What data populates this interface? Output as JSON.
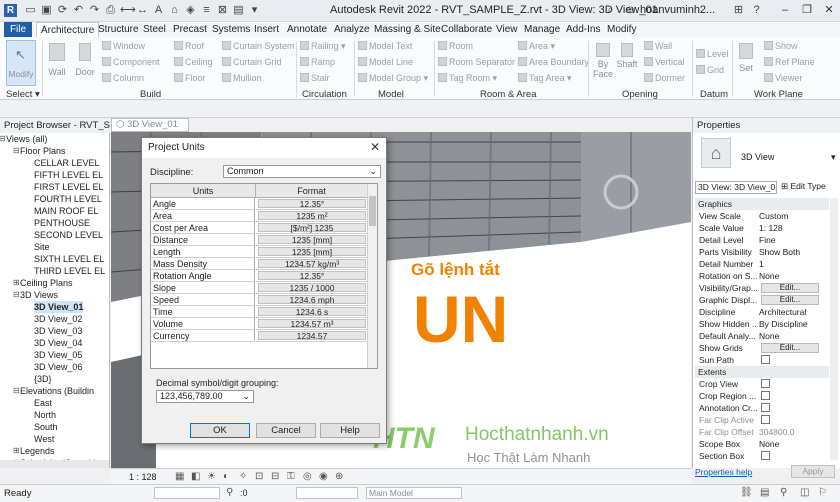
{
  "app": {
    "title": "Autodesk Revit 2022 - RVT_SAMPLE_Z.rvt - 3D View: 3D View_01",
    "user": "hoanvuminh2...",
    "accent": "#1f5fa8"
  },
  "menu": {
    "file": "File",
    "tabs": [
      "Architecture",
      "Structure",
      "Steel",
      "Precast",
      "Systems",
      "Insert",
      "Annotate",
      "Analyze",
      "Massing & Site",
      "Collaborate",
      "View",
      "Manage",
      "Add-Ins",
      "Modify"
    ]
  },
  "ribbon": {
    "modify": "Modify",
    "select": "Select ▾",
    "wall": "Wall",
    "door": "Door",
    "window": "Window",
    "component": "Component",
    "column": "Column",
    "roof": "Roof",
    "ceiling": "Ceiling",
    "floor": "Floor",
    "curtain_system": "Curtain System",
    "curtain_grid": "Curtain Grid",
    "mullion": "Mullion",
    "railing": "Railing",
    "ramp": "Ramp",
    "stair": "Stair",
    "model_text": "Model Text",
    "model_line": "Model Line",
    "model_group": "Model Group",
    "room": "Room",
    "room_separator": "Room Separator",
    "tag_room": "Tag Room",
    "area": "Area",
    "area_boundary": "Area Boundary",
    "tag_area": "Tag Area",
    "by_face": "By Face",
    "shaft": "Shaft",
    "wall_open": "Wall",
    "vertical": "Vertical",
    "dormer": "Dormer",
    "level": "Level",
    "grid": "Grid",
    "set": "Set",
    "show": "Show",
    "ref_plane": "Ref Plane",
    "viewer": "Viewer",
    "groups": [
      "Build",
      "Circulation",
      "Model",
      "Room & Area",
      "Opening",
      "Datum",
      "Work Plane"
    ]
  },
  "project_browser": {
    "header": "Project Browser - RVT_SAM...",
    "items": [
      "Views (all)",
      "Floor Plans",
      "CELLAR LEVEL",
      "FIFTH LEVEL EL",
      "FIRST LEVEL EL",
      "FOURTH LEVEL",
      "MAIN ROOF EL",
      "PENTHOUSE",
      "SECOND LEVEL",
      "Site",
      "SIXTH LEVEL EL",
      "THIRD LEVEL EL",
      "Ceiling Plans",
      "3D Views",
      "3D View_01",
      "3D View_02",
      "3D View_03",
      "3D View_04",
      "3D View_05",
      "3D View_06",
      "{3D}",
      "Elevations (Buildin",
      "East",
      "North",
      "South",
      "West",
      "Legends",
      "Schedules/Quantiti"
    ]
  },
  "view_tab": "3D View_01",
  "overlay": {
    "caption": "Gõ lệnh tắt",
    "command": "UN",
    "color": "#f08200",
    "logo_brand": "HTN",
    "logo_site": "Hocthatnhanh.vn",
    "logo_slogan": "Học Thật  Làm Nhanh"
  },
  "dialog": {
    "title": "Project Units",
    "discipline_label": "Discipline:",
    "discipline_value": "Common",
    "col_units": "Units",
    "col_format": "Format",
    "rows": [
      {
        "unit": "Angle",
        "format": "12.35°"
      },
      {
        "unit": "Area",
        "format": "1235 m²"
      },
      {
        "unit": "Cost per Area",
        "format": "[$/m²] 1235"
      },
      {
        "unit": "Distance",
        "format": "1235 [mm]"
      },
      {
        "unit": "Length",
        "format": "1235 [mm]"
      },
      {
        "unit": "Mass Density",
        "format": "1234.57 kg/m³"
      },
      {
        "unit": "Rotation Angle",
        "format": "12.35°"
      },
      {
        "unit": "Slope",
        "format": "1235 / 1000"
      },
      {
        "unit": "Speed",
        "format": "1234.6 mph"
      },
      {
        "unit": "Time",
        "format": "1234.6 s"
      },
      {
        "unit": "Volume",
        "format": "1234.57 m³"
      },
      {
        "unit": "Currency",
        "format": "1234.57"
      }
    ],
    "decimal_label": "Decimal symbol/digit grouping:",
    "decimal_value": "123,456,789.00",
    "ok": "OK",
    "cancel": "Cancel",
    "help": "Help"
  },
  "properties": {
    "header": "Properties",
    "type_name": "3D View",
    "selector": "3D View: 3D View_01",
    "edit_type": "Edit Type",
    "section_graphics": "Graphics",
    "section_extents": "Extents",
    "rows": [
      {
        "name": "View Scale",
        "value": "Custom"
      },
      {
        "name": "Scale Value",
        "value": "1:  128"
      },
      {
        "name": "Detail Level",
        "value": "Fine"
      },
      {
        "name": "Parts Visibility",
        "value": "Show Both"
      },
      {
        "name": "Detail Number",
        "value": "1"
      },
      {
        "name": "Rotation on S...",
        "value": "None"
      },
      {
        "name": "Visibility/Grap...",
        "value": "Edit..."
      },
      {
        "name": "Graphic Displ...",
        "value": "Edit..."
      },
      {
        "name": "Discipline",
        "value": "Architectural"
      },
      {
        "name": "Show Hidden ...",
        "value": "By Discipline"
      },
      {
        "name": "Default Analy...",
        "value": "None"
      },
      {
        "name": "Show Grids",
        "value": "Edit..."
      },
      {
        "name": "Sun Path",
        "value": ""
      },
      {
        "name": "Crop View",
        "value": ""
      },
      {
        "name": "Crop Region ...",
        "value": ""
      },
      {
        "name": "Annotation Cr...",
        "value": ""
      },
      {
        "name": "Far Clip Active",
        "value": ""
      },
      {
        "name": "Far Clip Offset",
        "value": "304800.0"
      },
      {
        "name": "Scope Box",
        "value": "None"
      },
      {
        "name": "Section Box",
        "value": ""
      }
    ],
    "help_link": "Properties help",
    "apply": "Apply"
  },
  "viewbar": {
    "scale": "1 : 128"
  },
  "status": {
    "ready": "Ready",
    "zero": ":0",
    "workset": "Main Model"
  }
}
